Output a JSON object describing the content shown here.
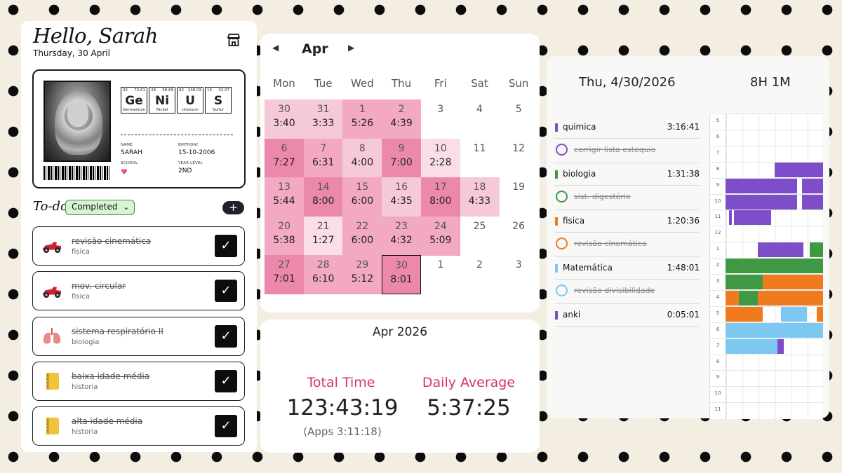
{
  "left": {
    "greeting": "Hello, Sarah",
    "date": "Thursday, 30 April",
    "icon": "store-icon",
    "id_card": {
      "elements": [
        {
          "num": "32",
          "mass": "72.61",
          "sym": "Ge",
          "name": "Germanium"
        },
        {
          "num": "28",
          "mass": "58.69",
          "sym": "Ni",
          "name": "Nickel"
        },
        {
          "num": "92",
          "mass": "238.03",
          "sym": "U",
          "name": "Uranium"
        },
        {
          "num": "16",
          "mass": "32.07",
          "sym": "S",
          "name": "Sulfur"
        }
      ],
      "name_label": "NAME",
      "name": "SARAH",
      "birthday_label": "BIRTHDAY",
      "birthday": "15-10-2006",
      "school_label": "SCHOOL",
      "school": "♥",
      "year_label": "YEAR LEVEL",
      "year": "2ND"
    },
    "todo_title": "To-do",
    "filter": "Completed",
    "add_label": "+",
    "tasks": [
      {
        "name": "revisão cinemática",
        "subject": "fisica",
        "icon": "race-car-icon"
      },
      {
        "name": "mov. circular",
        "subject": "fisica",
        "icon": "race-car-icon"
      },
      {
        "name": "sistema respiratório II",
        "subject": "biologia",
        "icon": "lungs-icon"
      },
      {
        "name": "baixa idade média",
        "subject": "historia",
        "icon": "notebook-icon"
      },
      {
        "name": "alta idade média",
        "subject": "historia",
        "icon": "notebook-icon"
      }
    ]
  },
  "calendar": {
    "month": "Apr",
    "prev_label": "◀",
    "next_label": "▶",
    "weekdays": [
      "Mon",
      "Tue",
      "Wed",
      "Thu",
      "Fri",
      "Sat",
      "Sun"
    ],
    "weeks": [
      [
        {
          "d": "30",
          "t": "3:40",
          "c": "#f6c9d9"
        },
        {
          "d": "31",
          "t": "3:33",
          "c": "#f6c9d9"
        },
        {
          "d": "1",
          "t": "5:26",
          "c": "#f3a8c4"
        },
        {
          "d": "2",
          "t": "4:39",
          "c": "#f3a8c4"
        },
        {
          "d": "3",
          "t": "",
          "c": ""
        },
        {
          "d": "4",
          "t": "",
          "c": ""
        },
        {
          "d": "5",
          "t": "",
          "c": ""
        }
      ],
      [
        {
          "d": "6",
          "t": "7:27",
          "c": "#ed88ad"
        },
        {
          "d": "7",
          "t": "6:31",
          "c": "#f3a8c4"
        },
        {
          "d": "8",
          "t": "4:00",
          "c": "#f6c9d9"
        },
        {
          "d": "9",
          "t": "7:00",
          "c": "#ed88ad"
        },
        {
          "d": "10",
          "t": "2:28",
          "c": "#fadde7"
        },
        {
          "d": "11",
          "t": "",
          "c": ""
        },
        {
          "d": "12",
          "t": "",
          "c": ""
        }
      ],
      [
        {
          "d": "13",
          "t": "5:44",
          "c": "#f3a8c4"
        },
        {
          "d": "14",
          "t": "8:00",
          "c": "#ed88ad"
        },
        {
          "d": "15",
          "t": "6:00",
          "c": "#f3a8c4"
        },
        {
          "d": "16",
          "t": "4:35",
          "c": "#f6c9d9"
        },
        {
          "d": "17",
          "t": "8:00",
          "c": "#ed88ad"
        },
        {
          "d": "18",
          "t": "4:33",
          "c": "#f6c9d9"
        },
        {
          "d": "19",
          "t": "",
          "c": ""
        }
      ],
      [
        {
          "d": "20",
          "t": "5:38",
          "c": "#f3a8c4"
        },
        {
          "d": "21",
          "t": "1:27",
          "c": "#fadde7"
        },
        {
          "d": "22",
          "t": "6:00",
          "c": "#f3a8c4"
        },
        {
          "d": "23",
          "t": "4:32",
          "c": "#f3a8c4"
        },
        {
          "d": "24",
          "t": "5:09",
          "c": "#f3a8c4"
        },
        {
          "d": "25",
          "t": "",
          "c": ""
        },
        {
          "d": "26",
          "t": "",
          "c": ""
        }
      ],
      [
        {
          "d": "27",
          "t": "7:01",
          "c": "#ed88ad"
        },
        {
          "d": "28",
          "t": "6:10",
          "c": "#f3a8c4"
        },
        {
          "d": "29",
          "t": "5:12",
          "c": "#f3a8c4"
        },
        {
          "d": "30",
          "t": "8:01",
          "c": "#ed88ad",
          "today": true
        },
        {
          "d": "1",
          "t": "",
          "c": ""
        },
        {
          "d": "2",
          "t": "",
          "c": ""
        },
        {
          "d": "3",
          "t": "",
          "c": ""
        }
      ]
    ]
  },
  "stats": {
    "month_label": "Apr 2026",
    "total_label": "Total Time",
    "total_value": "123:43:19",
    "apps_value": "(Apps 3:11:18)",
    "avg_label": "Daily Average",
    "avg_value": "5:37:25"
  },
  "right": {
    "date": "Thu, 4/30/2026",
    "total": "8H 1M",
    "subjects": [
      {
        "name": "quimica",
        "time": "3:16:41",
        "color": "#7e4ec8",
        "task": "corrigir lista estequio"
      },
      {
        "name": "biologia",
        "time": "1:31:38",
        "color": "#3f9944",
        "task": "sist. digestório"
      },
      {
        "name": "fisica",
        "time": "1:20:36",
        "color": "#f07b1f",
        "task": "revisão cinemática"
      },
      {
        "name": "Matemática",
        "time": "1:48:01",
        "color": "#7cc8f0",
        "task": "revisão divisibilidade"
      },
      {
        "name": "anki",
        "time": "0:05:01",
        "color": "#7e4ec8",
        "task": ""
      }
    ],
    "hours": [
      "5",
      "6",
      "7",
      "8",
      "9",
      "10",
      "11",
      "12",
      "1",
      "2",
      "3",
      "4",
      "5",
      "6",
      "7",
      "8",
      "9",
      "10",
      "11"
    ]
  }
}
